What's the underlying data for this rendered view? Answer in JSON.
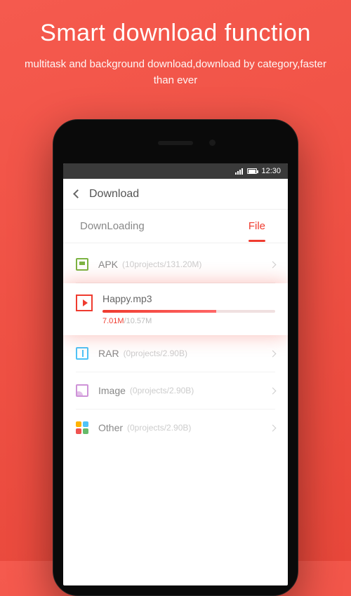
{
  "promo": {
    "title": "Smart download function",
    "subtitle": "multitask and background download,download by category,faster than ever"
  },
  "status": {
    "time": "12:30"
  },
  "header": {
    "title": "Download"
  },
  "tabs": {
    "downloading": "DownLoading",
    "file": "File"
  },
  "categories": {
    "apk": {
      "label": "APK",
      "meta": "(10projects/131.20M)"
    },
    "rar": {
      "label": "RAR",
      "meta": "(0projects/2.90B)"
    },
    "image": {
      "label": "Image",
      "meta": "(0projects/2.90B)"
    },
    "other": {
      "label": "Other",
      "meta": "(0projects/2.90B)"
    }
  },
  "active": {
    "name": "Happy.mp3",
    "done": "7.01M",
    "sep": "/",
    "total": "10.57M"
  }
}
